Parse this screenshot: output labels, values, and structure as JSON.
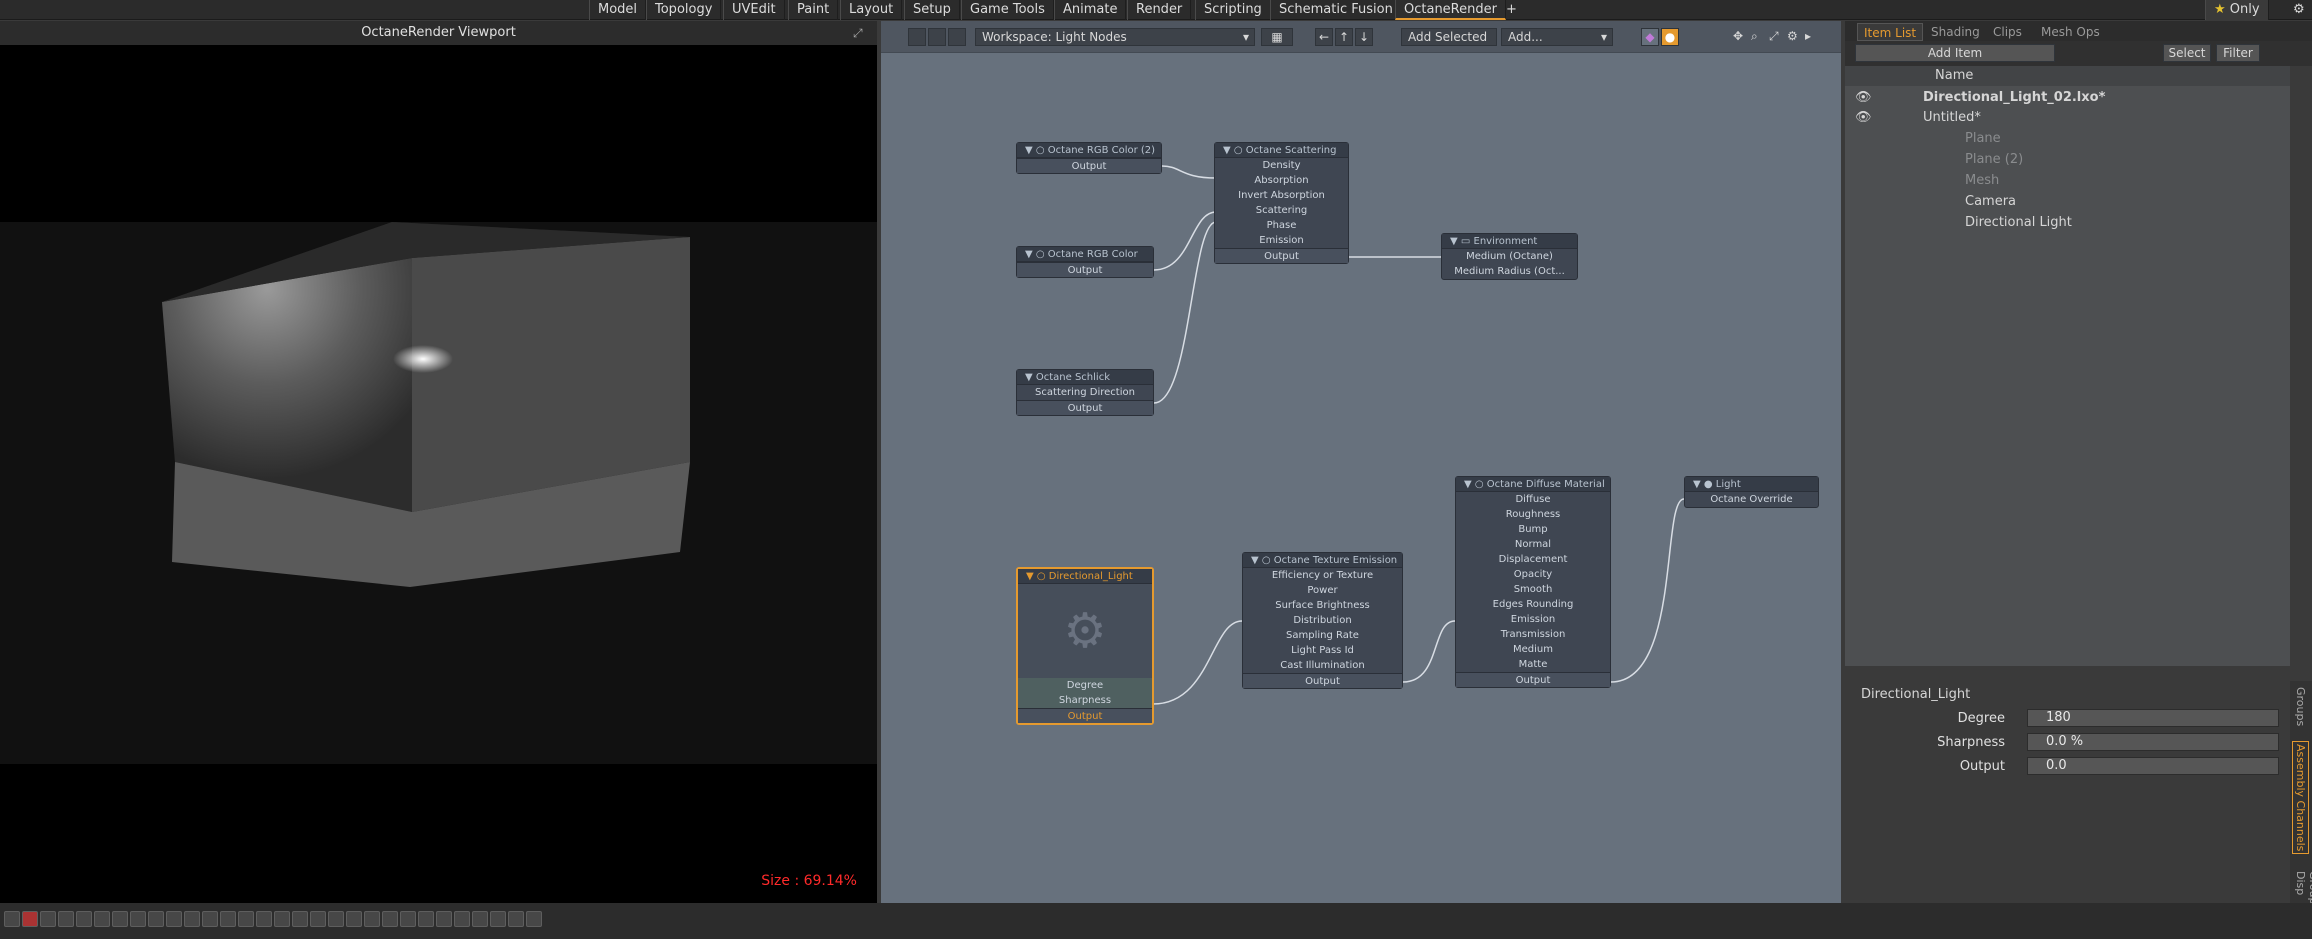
{
  "menu": {
    "tabs": [
      "Model",
      "Topology",
      "UVEdit",
      "Paint",
      "Layout",
      "Setup",
      "Game Tools",
      "Animate",
      "Render",
      "Scripting",
      "Schematic Fusion",
      "OctaneRender"
    ],
    "active_tab": "OctaneRender",
    "add_tab": "+",
    "only_label": "Only"
  },
  "viewport": {
    "title": "OctaneRender Viewport",
    "size_label": "Size : 69.14%"
  },
  "node_editor": {
    "workspace": "Workspace: Light Nodes",
    "add_selected": "Add Selected",
    "add_placeholder": "Add...",
    "nodes": {
      "rgb2": {
        "title": "Octane RGB Color (2)",
        "output": "Output"
      },
      "rgb1": {
        "title": "Octane RGB Color",
        "output": "Output"
      },
      "schlick": {
        "title": "Octane Schlick",
        "inputs": [
          "Scattering Direction"
        ],
        "output": "Output"
      },
      "scattering": {
        "title": "Octane Scattering",
        "inputs": [
          "Density",
          "Absorption",
          "Invert Absorption",
          "Scattering",
          "Phase",
          "Emission"
        ],
        "output": "Output"
      },
      "environment": {
        "title": "Environment",
        "inputs": [
          "Medium (Octane)",
          "Medium Radius (Oct..."
        ]
      },
      "directional": {
        "title": "Directional_Light",
        "inputs": [
          "Degree",
          "Sharpness"
        ],
        "output": "Output"
      },
      "texture_emission": {
        "title": "Octane Texture Emission",
        "inputs": [
          "Efficiency or Texture",
          "Power",
          "Surface Brightness",
          "Distribution",
          "Sampling Rate",
          "Light Pass Id",
          "Cast Illumination"
        ],
        "output": "Output"
      },
      "diffuse": {
        "title": "Octane Diffuse Material",
        "inputs": [
          "Diffuse",
          "Roughness",
          "Bump",
          "Normal",
          "Displacement",
          "Opacity",
          "Smooth",
          "Edges Rounding",
          "Emission",
          "Transmission",
          "Medium",
          "Matte"
        ],
        "output": "Output"
      },
      "light": {
        "title": "Light",
        "inputs": [
          "Octane Override"
        ]
      }
    }
  },
  "right_panel": {
    "tabs": [
      "Item List",
      "Shading",
      "Clips",
      "Mesh Ops"
    ],
    "active_tab": "Item List",
    "add_item": "Add Item",
    "select": "Select",
    "filter": "Filter",
    "col_name": "Name",
    "items": [
      {
        "label": "Directional_Light_02.lxo*",
        "bold": true
      },
      {
        "label": "Untitled*",
        "bold": false
      },
      {
        "label": "Plane",
        "dim": true
      },
      {
        "label": "Plane (2)",
        "dim": true
      },
      {
        "label": "Mesh",
        "dim": true
      },
      {
        "label": "Camera",
        "dim": false
      },
      {
        "label": "Directional Light",
        "dim": false
      }
    ],
    "props_title": "Directional_Light",
    "props": [
      {
        "label": "Degree",
        "value": "180"
      },
      {
        "label": "Sharpness",
        "value": "0.0 %"
      },
      {
        "label": "Output",
        "value": "0.0"
      }
    ],
    "side_tabs": [
      "Groups",
      "Assembly Channels",
      "Group Disp"
    ]
  },
  "colors": {
    "accent": "#e59a2f",
    "node_bg": "#67717d",
    "size_label": "#ff2a2a"
  }
}
